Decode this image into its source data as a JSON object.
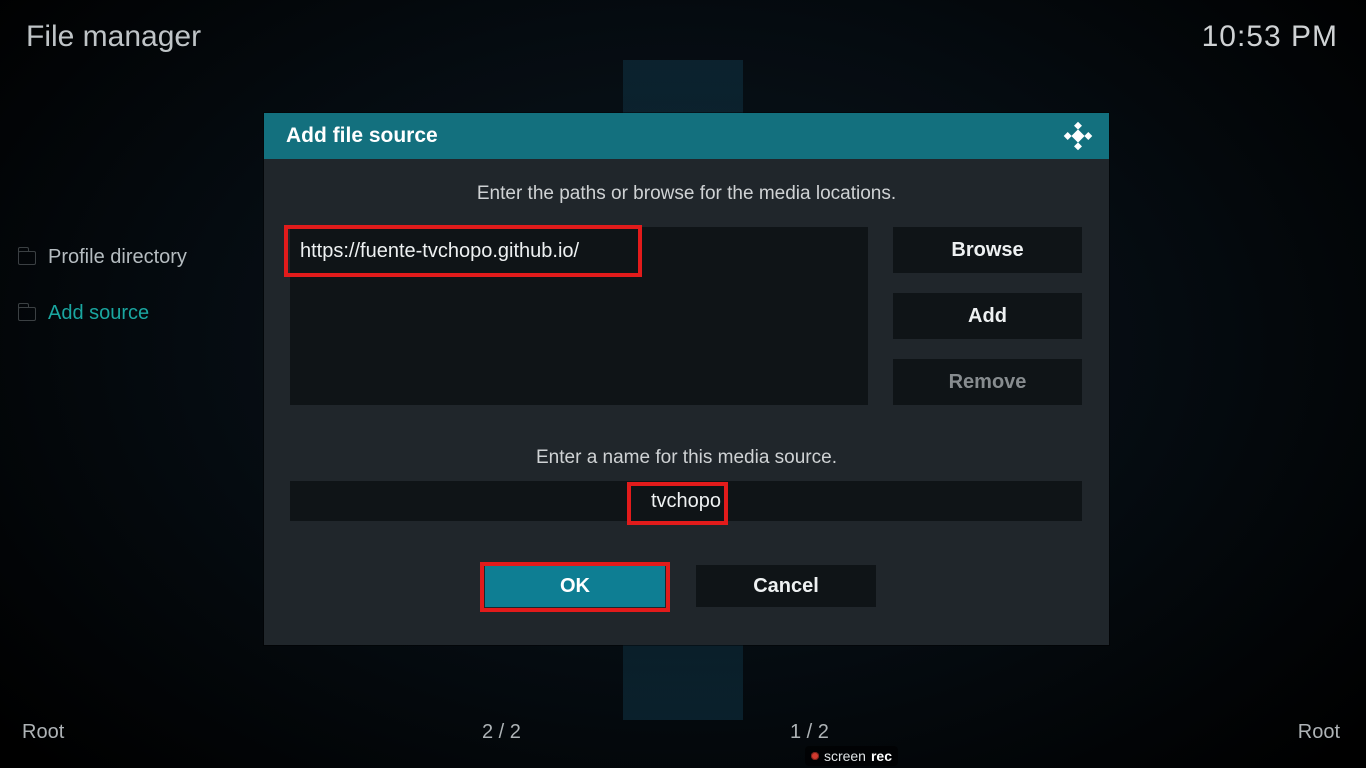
{
  "header": {
    "title": "File manager",
    "clock": "10:53 PM"
  },
  "sidebar": {
    "items": [
      {
        "icon": "folder-icon",
        "label": "Profile directory"
      },
      {
        "icon": "folder-icon",
        "label": "Add source"
      }
    ]
  },
  "dialog": {
    "title": "Add file source",
    "hint_paths": "Enter the paths or browse for the media locations.",
    "hint_name": "Enter a name for this media source.",
    "path_value": "https://fuente-tvchopo.github.io/",
    "name_value": "tvchopo",
    "buttons": {
      "browse": "Browse",
      "add": "Add",
      "remove": "Remove",
      "ok": "OK",
      "cancel": "Cancel"
    }
  },
  "footer": {
    "left_root": "Root",
    "counter_left": "2 / 2",
    "counter_right": "1 / 2",
    "right_root": "Root"
  },
  "badge": {
    "brand_a": "screen",
    "brand_b": "rec"
  }
}
